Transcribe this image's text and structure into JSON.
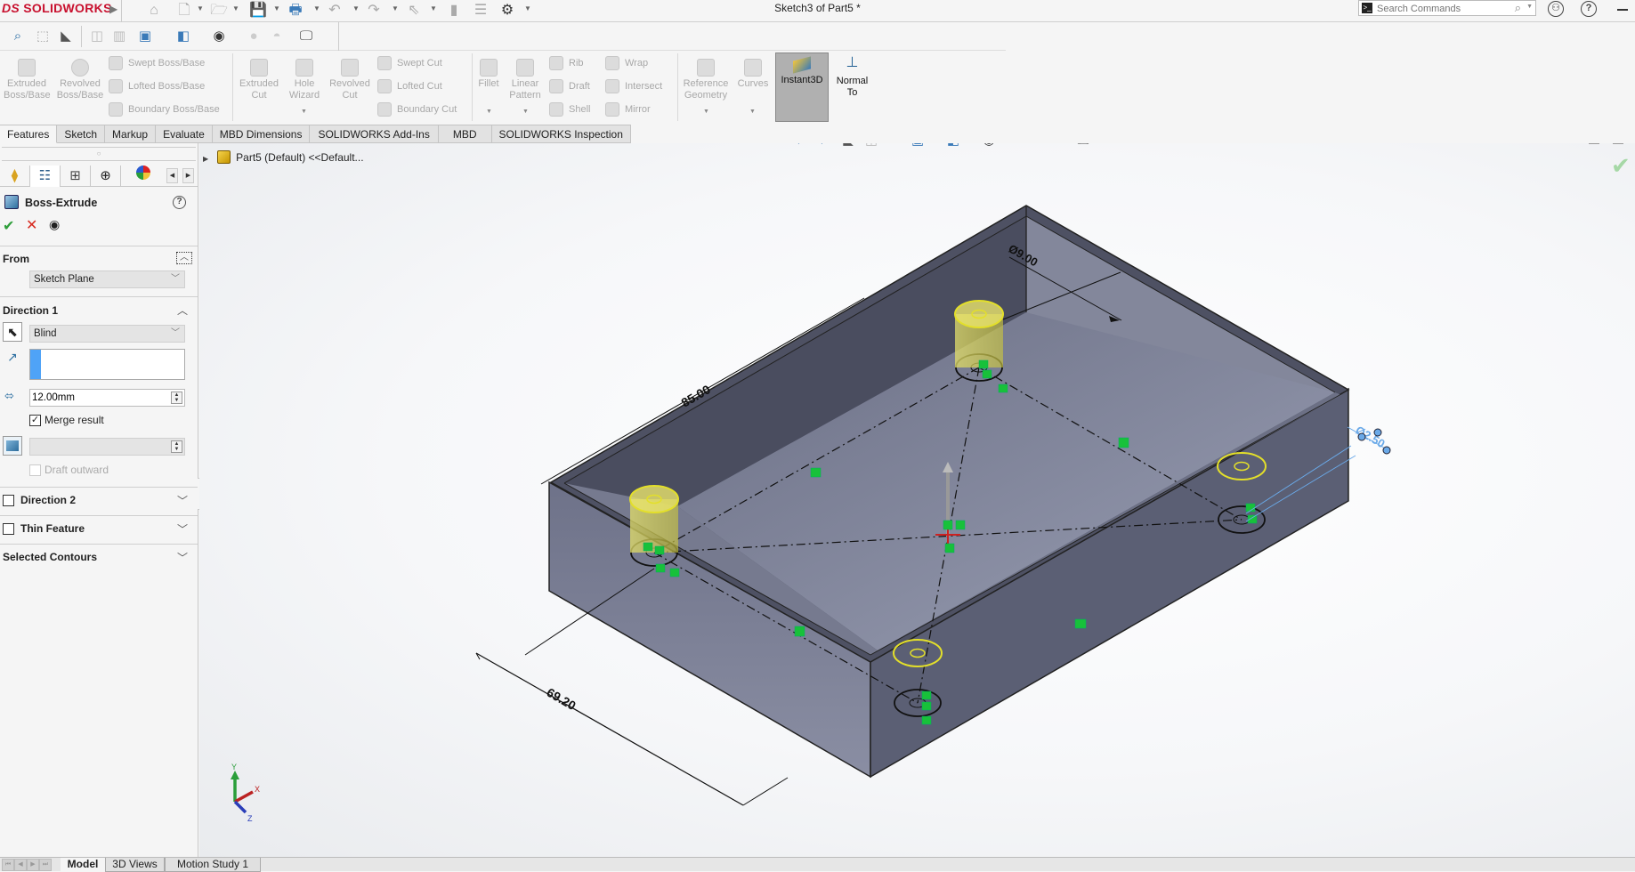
{
  "app": {
    "brand": "SOLIDWORKS",
    "brand_prefix": "DS",
    "document_title": "Sketch3 of Part5 *"
  },
  "titlebar": {
    "search_placeholder": "Search Commands",
    "quick_access_icons": [
      "home-icon",
      "new-document-icon",
      "open-icon",
      "save-icon",
      "print-icon",
      "undo-icon",
      "redo-icon",
      "select-icon",
      "rebuild-icon",
      "file-properties-icon",
      "options-gear-icon"
    ],
    "user_icon": "user-account-icon",
    "help_icon": "help-icon",
    "help_glyph": "?",
    "minimize_icon": "minimize-icon"
  },
  "command_manager": {
    "features": [
      {
        "label": "Extruded Boss/Base",
        "line1": "Extruded",
        "line2": "Boss/Base",
        "enabled": false
      },
      {
        "label": "Revolved Boss/Base",
        "line1": "Revolved",
        "line2": "Boss/Base",
        "enabled": false
      },
      {
        "label": "Extruded Cut",
        "line1": "Extruded",
        "line2": "Cut",
        "enabled": false
      },
      {
        "label": "Hole Wizard",
        "line1": "Hole",
        "line2": "Wizard",
        "enabled": false
      },
      {
        "label": "Revolved Cut",
        "line1": "Revolved",
        "line2": "Cut",
        "enabled": false
      },
      {
        "label": "Fillet",
        "line1": "Fillet",
        "line2": "",
        "enabled": false
      },
      {
        "label": "Linear Pattern",
        "line1": "Linear",
        "line2": "Pattern",
        "enabled": false
      },
      {
        "label": "Reference Geometry",
        "line1": "Reference",
        "line2": "Geometry",
        "enabled": false
      },
      {
        "label": "Curves",
        "line1": "Curves",
        "line2": "",
        "enabled": false
      }
    ],
    "small_features": [
      {
        "label": "Swept Boss/Base"
      },
      {
        "label": "Lofted Boss/Base"
      },
      {
        "label": "Boundary Boss/Base"
      },
      {
        "label": "Swept Cut"
      },
      {
        "label": "Lofted Cut"
      },
      {
        "label": "Boundary Cut"
      },
      {
        "label": "Rib"
      },
      {
        "label": "Draft"
      },
      {
        "label": "Shell"
      },
      {
        "label": "Wrap"
      },
      {
        "label": "Intersect"
      },
      {
        "label": "Mirror"
      }
    ],
    "instant3d": {
      "label": "Instant3D",
      "active": true
    },
    "normal_to": {
      "line1": "Normal",
      "line2": "To"
    }
  },
  "tabs": [
    {
      "label": "Features",
      "active": true
    },
    {
      "label": "Sketch",
      "active": false
    },
    {
      "label": "Markup",
      "active": false
    },
    {
      "label": "Evaluate",
      "active": false
    },
    {
      "label": "MBD Dimensions",
      "active": false
    },
    {
      "label": "SOLIDWORKS Add-Ins",
      "active": false
    },
    {
      "label": "MBD",
      "active": false
    },
    {
      "label": "SOLIDWORKS Inspection",
      "active": false
    }
  ],
  "property_manager": {
    "panel_tabs": [
      "featuremanager-tree-icon",
      "propertymanager-icon",
      "configurationmanager-icon",
      "dimxpert-icon",
      "display-manager-icon"
    ],
    "title": "Boss-Extrude",
    "ok_glyph": "✔",
    "cancel_glyph": "✕",
    "preview_glyph": "👁",
    "from": {
      "label": "From",
      "value": "Sketch Plane"
    },
    "direction1": {
      "label": "Direction 1",
      "end_condition": "Blind",
      "depth": "12.00mm",
      "merge_result": {
        "label": "Merge result",
        "checked": true
      },
      "draft_value": "",
      "draft_outward": {
        "label": "Draft outward",
        "checked": false,
        "enabled": false
      }
    },
    "direction2": {
      "label": "Direction 2",
      "checked": false
    },
    "thin_feature": {
      "label": "Thin Feature",
      "checked": false
    },
    "selected_contours": {
      "label": "Selected Contours"
    }
  },
  "viewport": {
    "tree_root": "Part5 (Default) <<Default...",
    "dimensions": {
      "length": "85.00",
      "width": "69.20",
      "boss_diameter": "Ø9.00",
      "hole_diameter": "Ø2.50"
    },
    "triad": {
      "x": "X",
      "y": "Y",
      "z": "Z"
    },
    "confirm_glyph": "✔"
  },
  "bottom_tabs": [
    {
      "label": "Model",
      "active": true
    },
    {
      "label": "3D Views",
      "active": false
    },
    {
      "label": "Motion Study 1",
      "active": false
    }
  ],
  "colors": {
    "brand_red": "#c8102e",
    "ok_green": "#2e9e3a",
    "cancel_red": "#d72a1f",
    "selection_blue": "#4fa3f7",
    "model_face": "#7b7f94",
    "preview_yellow": "#e6e34a",
    "relation_green": "#18c13a"
  }
}
